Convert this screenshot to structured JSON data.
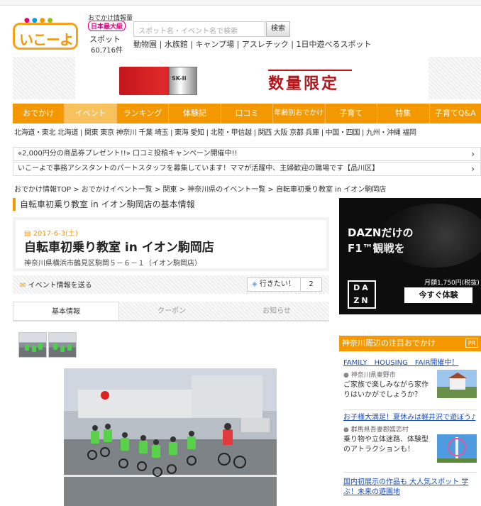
{
  "header": {
    "logo_text": "いこーよ",
    "tag_top": "おでかけ情報量",
    "tag_badge": "日本最大級",
    "spot_label": "スポット",
    "spot_count": "60,716件",
    "search_placeholder": "スポット名・イベント名で検索",
    "search_button": "検索",
    "quick_links": "動物園 | 水族館 | キャンプ場 | アスレチック | 1日中遊べるスポット"
  },
  "banner": {
    "brand": "SK-II",
    "headline": "数量限定"
  },
  "nav": {
    "items": [
      "おでかけ",
      "イベント",
      "ランキング",
      "体験記",
      "口コミ",
      "年齢別おでかけ",
      "子育て",
      "特集",
      "子育てQ&A"
    ],
    "regions": "北海道・東北 北海道 | 関東 東京 神奈川 千葉 埼玉 | 東海 愛知 | 北陸・甲信越 | 関西 大阪 京都 兵庫 | 中国・四国 | 九州・沖縄 福岡"
  },
  "notices": [
    "«2,000円分の商品券プレゼント!!» 口コミ投稿キャンペーン開催中!!",
    "いこーよで事務アシスタントのパートスタッフを募集しています！ママが活躍中、主婦歓迎の職場です【品川区】"
  ],
  "breadcrumb": "おでかけ情報TOP > おでかけイベント一覧 > 関東 > 神奈川県のイベント一覧 > 自転車初乗り教室 in イオン駒岡店",
  "breadcrumb_current": "自転車初乗り教室 in イオン駒岡店",
  "section_title": "自転車初乗り教室 in イオン駒岡店の基本情報",
  "event": {
    "date": "2017-6-3(土)",
    "title": "自転車初乗り教室 in イオン駒岡店",
    "address": "神奈川県横浜市鶴見区駒岡５－６－１（イオン駒岡店）",
    "send_label": "イベント情報を送る",
    "want_label": "行きたい！",
    "want_count": "2"
  },
  "tabs": [
    "基本情報",
    "クーポン",
    "お知らせ"
  ],
  "ad": {
    "line1": "DAZNだけの",
    "line2": "F1™観戦を",
    "logo": "DAZN",
    "price": "月額1,750円(税抜)",
    "cta": "今すぐ体験"
  },
  "pickup": {
    "heading": "神奈川周辺の注目おでかけ",
    "pr": "PR",
    "items": [
      {
        "title": "FAMILY　HOUSING　FAIR開催中！",
        "location": "神奈川県秦野市",
        "desc": "ご家族で楽しみながら家作りはいかがでしょうか？"
      },
      {
        "title": "お子様大満足！夏休みは軽井沢で遊ぼう♪",
        "location": "群馬県吾妻郡嬬恋村",
        "desc": "乗り物や立体迷路、体験型のアトラクションも！"
      },
      {
        "title": "国内初展示の作品も 大人気スポット 学ぶ！未来の遊園地",
        "location": "",
        "desc": ""
      }
    ]
  },
  "colors": {
    "accent": "#f39800",
    "link": "#1a4db8",
    "banner_red": "#b4141a"
  }
}
